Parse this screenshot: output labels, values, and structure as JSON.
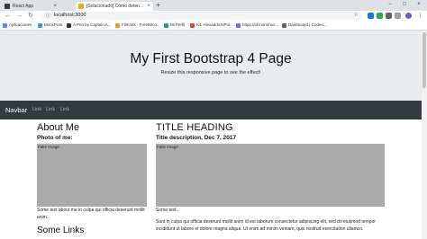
{
  "browser": {
    "tabs": [
      {
        "title": "React App",
        "active": false,
        "color": "#3a3a3a"
      },
      {
        "title": "[Solucionado] Cómo detener un",
        "active": true,
        "color": "#f4a623"
      }
    ],
    "new_tab_symbol": "+",
    "window_controls": [
      "−",
      "□",
      "×"
    ],
    "url": "localhost:3000",
    "bookmarks": [
      {
        "label": "Aplicaciones",
        "color": "#4c8bf5"
      },
      {
        "label": "MockFlow",
        "color": "#2e9fd8"
      },
      {
        "label": "A Pen by Captain A...",
        "color": "#333333"
      },
      {
        "label": "Film44k - FreeBitco...",
        "color": "#f7931a"
      },
      {
        "label": "Mi Perfil",
        "color": "#1da462"
      },
      {
        "label": "Kit: AlexaddictsPol...",
        "color": "#ea4335"
      },
      {
        "label": "https://id.loom/nxo...",
        "color": "#7b61ff"
      },
      {
        "label": "Dashboard | Codeo...",
        "color": "#5f6368"
      }
    ]
  },
  "page": {
    "jumbotron": {
      "title": "My First Bootstrap 4 Page",
      "subtitle": "Resize this responsive page to see the effect!"
    },
    "navbar": {
      "brand": "Navbar",
      "links": [
        "Link",
        "Link",
        "Link"
      ]
    },
    "left_column": {
      "heading": "About Me",
      "subheading": "Photo of me:",
      "image_label": "Fake Image",
      "text": "Some text about me in culpa qui officia deserunt mollit anim..",
      "links_heading": "Some Links"
    },
    "right_column": {
      "heading": "TITLE HEADING",
      "subheading": "Title description, Dec 7, 2017",
      "image_label": "Fake Image",
      "text_short": "Some text..",
      "text_long": "Sunt in culpa qui officia deserunt mollit anim id est laborum consectetur adipiscing elit, sed do eiusmod tempor incididunt ut labore et dolore magna aliqua. Ut enim ad minim veniam, quis nostrud exercitation ullamco."
    }
  },
  "colors": {
    "jumbotron_bg": "#e9ecef",
    "navbar_bg": "#343a40",
    "fake_image_bg": "#aaaaaa"
  }
}
